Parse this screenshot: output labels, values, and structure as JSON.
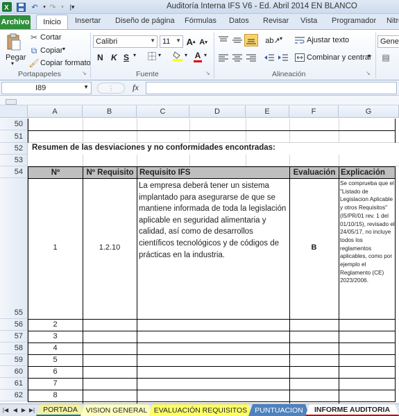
{
  "window": {
    "title": "Auditoría Interna IFS V6 - Ed. Abril 2014 EN BLANCO"
  },
  "ribbon_tabs": {
    "file": "Archivo",
    "items": [
      "Inicio",
      "Insertar",
      "Diseño de página",
      "Fórmulas",
      "Datos",
      "Revisar",
      "Vista",
      "Programador",
      "Nitro"
    ]
  },
  "clipboard": {
    "paste": "Pegar",
    "cut": "Cortar",
    "copy": "Copiar",
    "format_painter": "Copiar formato",
    "label": "Portapapeles"
  },
  "font": {
    "name": "Calibri",
    "size": "11",
    "bold": "N",
    "italic": "K",
    "underline": "S",
    "label": "Fuente"
  },
  "alignment": {
    "wrap": "Ajustar texto",
    "merge": "Combinar y centrar",
    "label": "Alineación"
  },
  "number": {
    "format": "Genera"
  },
  "formula_bar": {
    "name_box": "I89",
    "fx": "fx",
    "value": ""
  },
  "columns": [
    "A",
    "B",
    "C",
    "D",
    "E",
    "F",
    "G"
  ],
  "rows": [
    "50",
    "51",
    "52",
    "53",
    "54",
    "55",
    "56",
    "57",
    "58",
    "59",
    "60",
    "61",
    "62"
  ],
  "sheet": {
    "section_title": "Resumen de las desviaciones y no conformidades encontradas:",
    "table_headers": [
      "Nº",
      "Nº Requisito",
      "Requisito IFS",
      "Evaluación",
      "Explicación"
    ],
    "first_row": {
      "num": "1",
      "requisito": "1.2.10",
      "texto": "La empresa deberá tener un sistema implantado para asegurarse de que se mantiene informada de toda la legislación aplicable en seguridad alimentaria y calidad, así como de desarrollos científicos tecnológicos y de códigos de prácticas en la industria.",
      "evaluacion": "B",
      "explicacion": "Se comprueba que el \"Listado de Legislacion Aplicable y otros Requisitos\" (I5/PR/01 rev. 1 del 01/10/15), revisado el 24/05/17, no incluye todos los reglamentos aplicables, como por ejemplo el Reglamento (CE) 2023/2006."
    },
    "numbers": [
      "2",
      "3",
      "4",
      "5",
      "6",
      "7",
      "8"
    ]
  },
  "sheet_tabs": [
    "PORTADA",
    "VISION GENERAL",
    "EVALUACIÓN REQUISITOS",
    "PUNTUACION",
    "INFORME AUDITORIA"
  ],
  "colors": {
    "file_tab": "#2f8f3b",
    "header_fill": "#bfbfbf",
    "tab_portada": "#f2f2a0",
    "tab_vision": "#ffffc0",
    "tab_eval": "#ffff66",
    "tab_puntuacion": "#4f81bd",
    "tab_informe": "#ffffff"
  }
}
